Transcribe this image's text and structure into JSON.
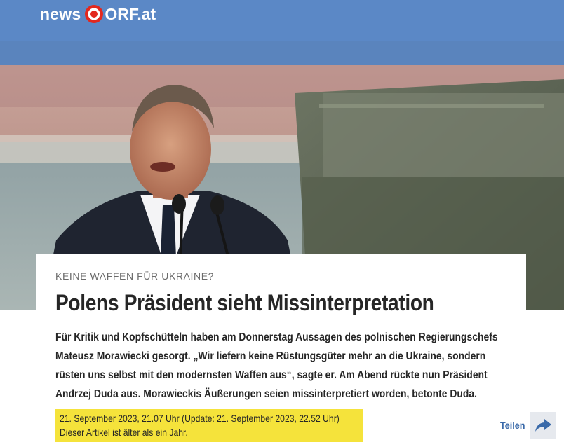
{
  "header": {
    "logo_news": "news",
    "logo_orf": "ORF.at",
    "brand_color": "#5b88c6"
  },
  "hero": {
    "icon": "photo-speaker-at-podium"
  },
  "article": {
    "kicker": "KEINE WAFFEN FÜR UKRAINE?",
    "title": "Polens Präsident sieht Missinterpretation",
    "lead_lines": [
      "Für Kritik und Kopfschütteln haben am Donnerstag Aussagen des polnischen Regierungschefs",
      "Mateusz Morawiecki gesorgt. „Wir liefern keine Rüstungsgüter mehr an die Ukraine, sondern",
      "rüsten uns selbst mit den modernsten Waffen aus“, sagte er. Am Abend rückte nun Präsident",
      "Andrzej Duda aus. Morawieckis Äußerungen seien missinterpretiert worden, betonte Duda."
    ],
    "date_line": "21. September 2023, 21.07 Uhr (Update: 21. September 2023, 22.52 Uhr)",
    "age_notice": "Dieser Artikel ist älter als ein Jahr.",
    "highlight_color": "#f5e33b"
  },
  "share": {
    "label": "Teilen",
    "icon": "share-arrow-icon"
  }
}
